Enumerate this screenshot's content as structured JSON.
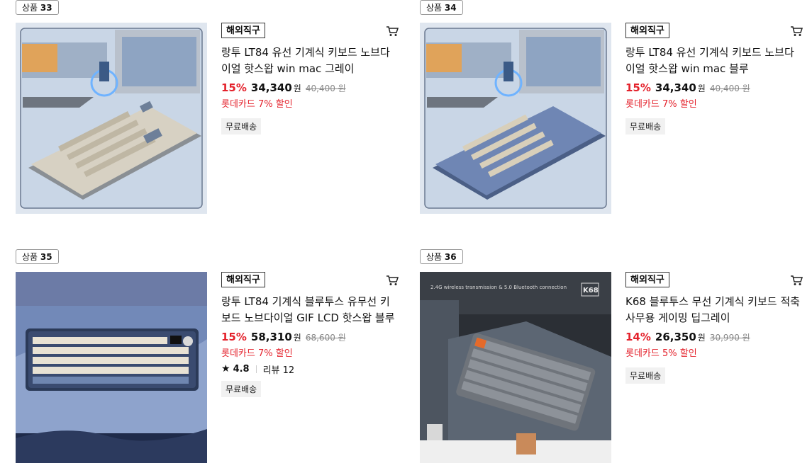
{
  "products": [
    {
      "rank_prefix": "상품",
      "rank_number": "33",
      "tag": "해외직구",
      "title": "랑투 LT84 유선 기계식 키보드 노브다이얼 핫스왑 win mac 그레이",
      "discount": "15%",
      "price": "34,340",
      "currency": "원",
      "original_price": "40,400 원",
      "card_discount": "롯데카드 7% 할인",
      "shipping": "무료배송"
    },
    {
      "rank_prefix": "상품",
      "rank_number": "34",
      "tag": "해외직구",
      "title": "랑투 LT84 유선 기계식 키보드 노브다이얼 핫스왑 win mac 블루",
      "discount": "15%",
      "price": "34,340",
      "currency": "원",
      "original_price": "40,400 원",
      "card_discount": "롯데카드 7% 할인",
      "shipping": "무료배송"
    },
    {
      "rank_prefix": "상품",
      "rank_number": "35",
      "tag": "해외직구",
      "title": "랑투 LT84 기계식 블루투스 유무선 키보드 노브다이얼 GIF LCD 핫스왑 블루",
      "discount": "15%",
      "price": "58,310",
      "currency": "원",
      "original_price": "68,600 원",
      "card_discount": "롯데카드 7% 할인",
      "rating": "4.8",
      "review_label": "리뷰 12",
      "shipping": "무료배송"
    },
    {
      "rank_prefix": "상품",
      "rank_number": "36",
      "tag": "해외직구",
      "title": "K68 블루투스 무선 기계식 키보드 적축 사무용 게이밍 딥그레이",
      "discount": "14%",
      "price": "26,350",
      "currency": "원",
      "original_price": "30,990 원",
      "card_discount": "롯데카드 5% 할인",
      "shipping": "무료배송"
    }
  ],
  "image_texts": {
    "p36_banner": "2.4G wireless transmission & 5.0 Bluetooth connection",
    "p36_logo": "K68"
  },
  "colors": {
    "discount_red": "#e4222c",
    "strike_gray": "#888888"
  }
}
